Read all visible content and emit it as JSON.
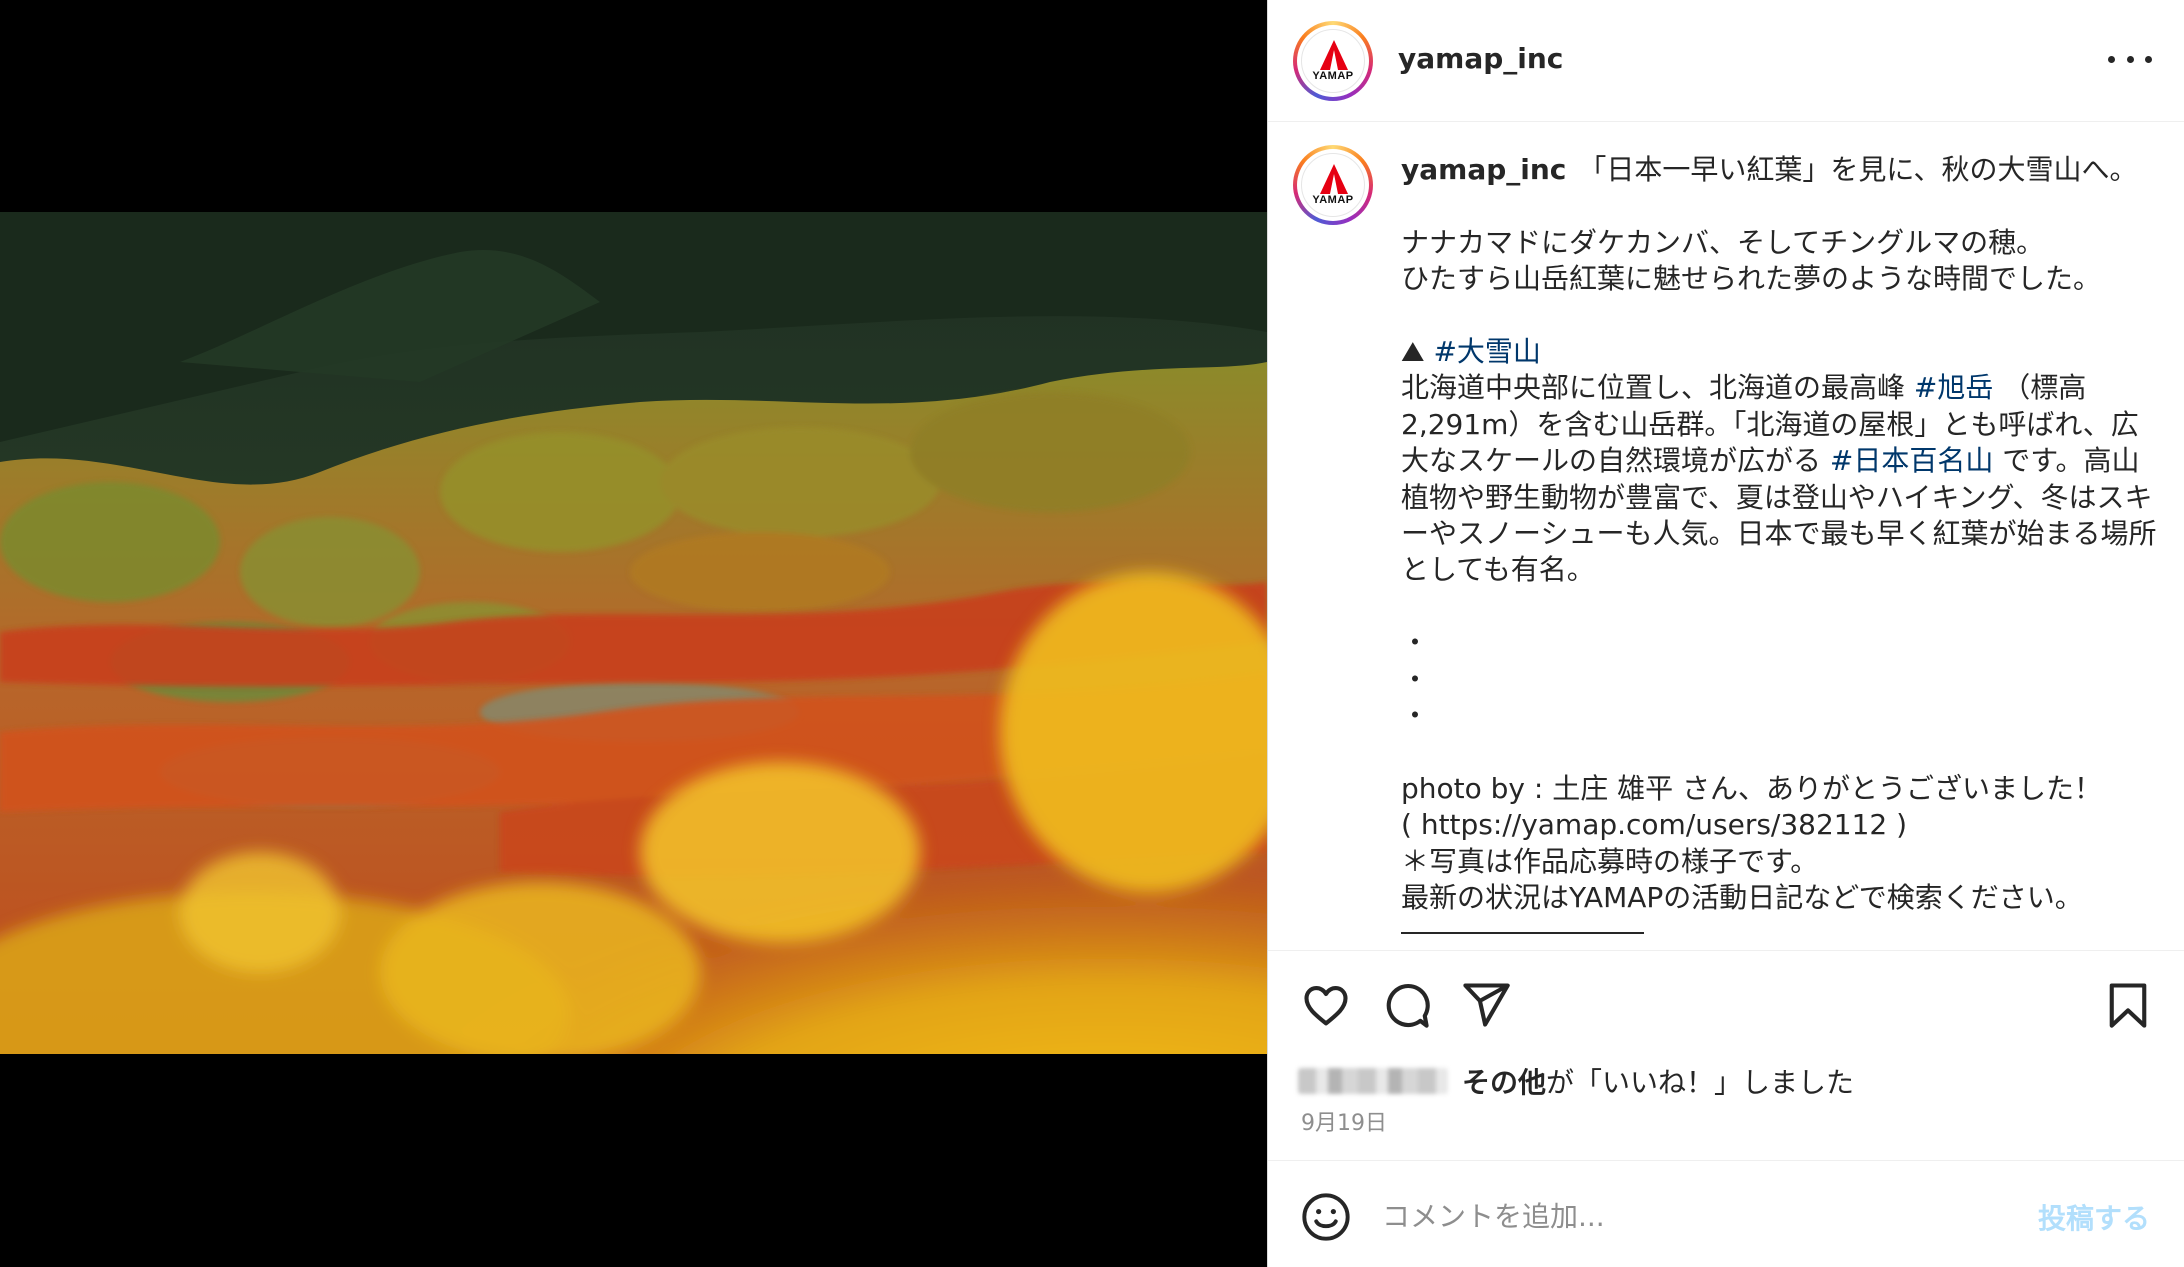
{
  "post": {
    "username": "yamap_inc",
    "avatar_logo_text": "YAMAP",
    "more_icon": "more-horizontal-icon",
    "caption": {
      "username": "yamap_inc",
      "line1": "「日本一早い紅葉」を見に、秋の大雪山へ。",
      "line2": "ナナカマドにダケカンバ、そしてチングルマの穂。",
      "line3": "ひたすら山岳紅葉に魅せられた夢のような時間でした。",
      "mountain_emoji": "⛰",
      "tag1": "#大雪山",
      "desc_a": "北海道中央部に位置し、北海道の最高峰 ",
      "tag2": "#旭岳",
      "desc_b": " （標高2,291m）を含む山岳群。「北海道の屋根」とも呼ばれ、広大なスケールの自然環境が広がる ",
      "tag3": "#日本百名山",
      "desc_c": " です。高山植物や野生動物が豊富で、夏は登山やハイキング、冬はスキーやスノーシューも人気。日本で最も早く紅葉が始まる場所としても有名。",
      "dot": "・",
      "photo_by": "photo by : 土庄 雄平 さん、ありがとうございました！",
      "link": "( https://yamap.com/users/382112 )",
      "note1": "＊写真は作品応募時の様子です。",
      "note2": "最新の状況はYAMAPの活動日記などで検索ください。"
    },
    "likes": {
      "others": "その他",
      "suffix": "が「いいね！」しました"
    },
    "date": "9月19日",
    "comment": {
      "placeholder": "コメントを追加...",
      "post_label": "投稿する"
    }
  },
  "icons": {
    "like": "heart-icon",
    "comment": "comment-bubble-icon",
    "share": "paper-plane-icon",
    "save": "bookmark-icon",
    "emoji": "smiley-icon"
  },
  "colors": {
    "hashtag": "#00376b",
    "post_button_disabled": "#b2dffc",
    "logo_red": "#e60012"
  }
}
